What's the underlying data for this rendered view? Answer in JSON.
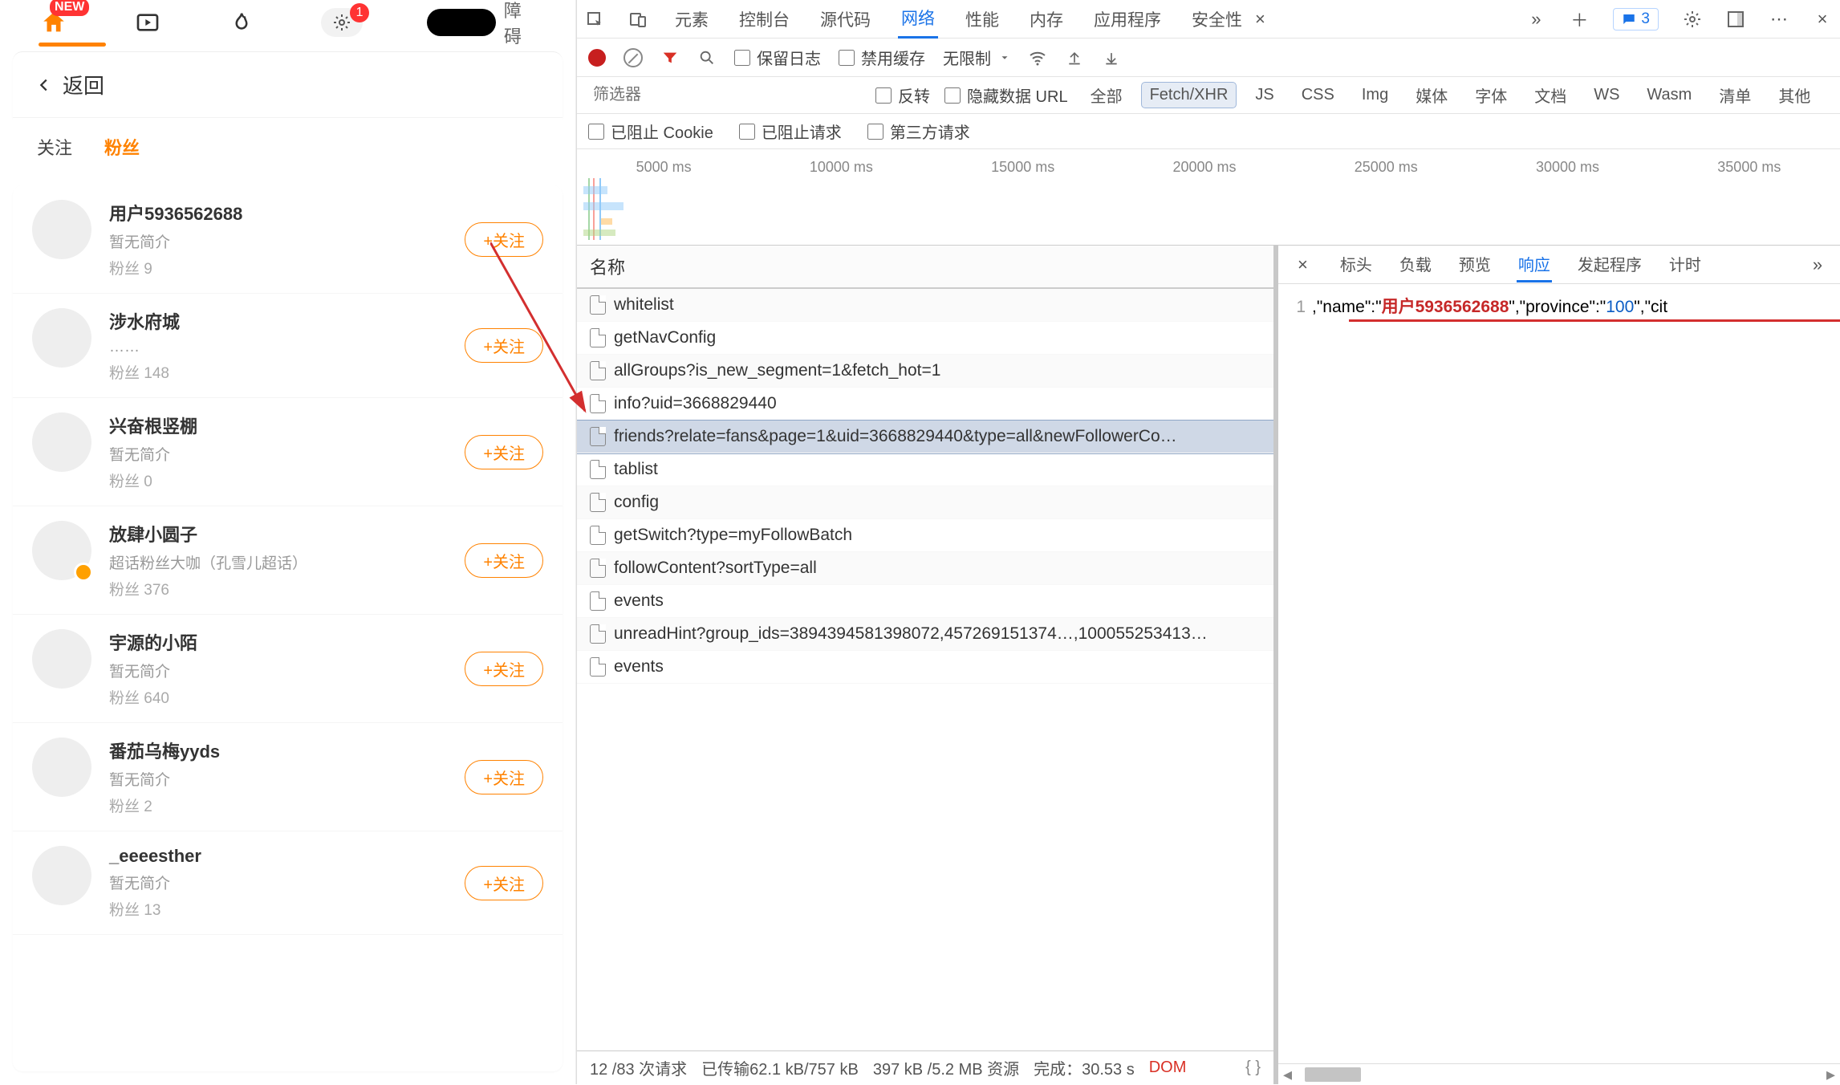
{
  "left": {
    "nav": {
      "badge_new": "NEW",
      "badge_count": "1",
      "accessibility_suffix": "障碍"
    },
    "back_label": "返回",
    "tabs": {
      "follow": "关注",
      "fans": "粉丝"
    },
    "follow_btn": "+关注",
    "fans_prefix": "粉丝",
    "users": [
      {
        "name": "用户5936562688",
        "sub": "暂无简介",
        "fans": "9",
        "v": false
      },
      {
        "name": "涉水府城",
        "sub": "……",
        "fans": "148",
        "v": false
      },
      {
        "name": "兴奋根竖棚",
        "sub": "暂无简介",
        "fans": "0",
        "v": false
      },
      {
        "name": "放肆小圆子",
        "sub": "超话粉丝大咖（孔雪儿超话）",
        "fans": "376",
        "v": true
      },
      {
        "name": "宇源的小陌",
        "sub": "暂无简介",
        "fans": "640",
        "v": false
      },
      {
        "name": "番茄乌梅yyds",
        "sub": "暂无简介",
        "fans": "2",
        "v": false
      },
      {
        "name": "_eeeesther",
        "sub": "暂无简介",
        "fans": "13",
        "v": false
      }
    ]
  },
  "devtools": {
    "tabs": [
      "元素",
      "控制台",
      "源代码",
      "网络",
      "性能",
      "内存",
      "应用程序",
      "安全性"
    ],
    "active_tab": "网络",
    "msg_count": "3",
    "toolbar": {
      "keep_log": "保留日志",
      "disable_cache": "禁用缓存",
      "throttle": "无限制"
    },
    "filter": {
      "placeholder": "筛选器",
      "invert": "反转",
      "hide_data": "隐藏数据 URL",
      "types": [
        "全部",
        "Fetch/XHR",
        "JS",
        "CSS",
        "Img",
        "媒体",
        "字体",
        "文档",
        "WS",
        "Wasm",
        "清单",
        "其他"
      ],
      "active_type": "Fetch/XHR"
    },
    "blocked": {
      "cookies": "已阻止 Cookie",
      "requests": "已阻止请求",
      "third": "第三方请求"
    },
    "timeline_ticks": [
      "5000 ms",
      "10000 ms",
      "15000 ms",
      "20000 ms",
      "25000 ms",
      "30000 ms",
      "35000 ms"
    ],
    "req_header": "名称",
    "requests": [
      "whitelist",
      "getNavConfig",
      "allGroups?is_new_segment=1&fetch_hot=1",
      "info?uid=3668829440",
      "friends?relate=fans&page=1&uid=3668829440&type=all&newFollowerCo…",
      "tablist",
      "config",
      "getSwitch?type=myFollowBatch",
      "followContent?sortType=all",
      "events",
      "unreadHint?group_ids=3894394581398072,457269151374…,100055253413…",
      "events"
    ],
    "selected_index": 4,
    "status": {
      "count": "12 /83 次请求",
      "xfer": "已传输62.1 kB/757 kB",
      "size": "397 kB /5.2 MB 资源",
      "done": "完成：30.53 s",
      "dom": "DOM"
    },
    "resp": {
      "tabs": [
        "标头",
        "负载",
        "预览",
        "响应",
        "发起程序",
        "计时"
      ],
      "active": "响应",
      "line_no": "1",
      "pre": ",\"name\":\"",
      "name_val": "用户5936562688",
      "mid": "\",\"province\":\"",
      "prov_val": "100",
      "post": "\",\"cit"
    }
  }
}
